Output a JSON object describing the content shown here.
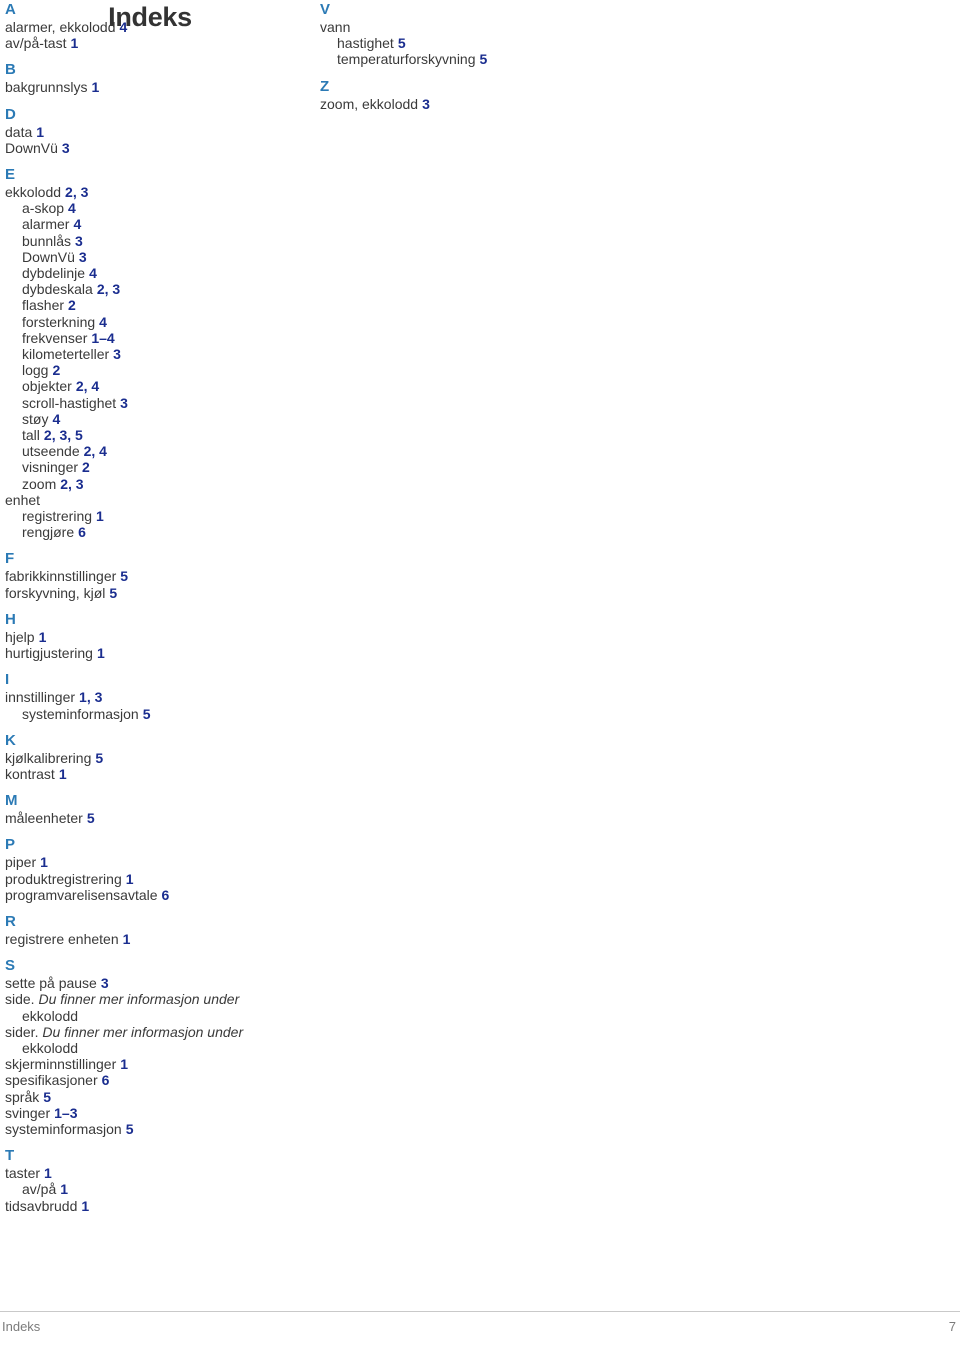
{
  "document": {
    "title": "Indeks"
  },
  "footer": {
    "label": "Indeks",
    "page_number": "7"
  },
  "colors": {
    "section_letter": "#2b7ab5",
    "page_number": "#1a2d8f",
    "body_text": "#3a3a3a",
    "title": "#333333",
    "footer_text": "#7b7b7b",
    "footer_rule": "#c9c9c9"
  },
  "index": {
    "left_column": [
      {
        "letter": "A",
        "entries": [
          {
            "level": 0,
            "term": "alarmer, ekkolodd",
            "pages": "4"
          },
          {
            "level": 0,
            "term": "av/på-tast",
            "pages": "1"
          }
        ]
      },
      {
        "letter": "B",
        "entries": [
          {
            "level": 0,
            "term": "bakgrunnslys",
            "pages": "1"
          }
        ]
      },
      {
        "letter": "D",
        "entries": [
          {
            "level": 0,
            "term": "data",
            "pages": "1"
          },
          {
            "level": 0,
            "term": "DownVü",
            "pages": "3"
          }
        ]
      },
      {
        "letter": "E",
        "entries": [
          {
            "level": 0,
            "term": "ekkolodd",
            "pages": "2, 3"
          },
          {
            "level": 1,
            "term": "a-skop",
            "pages": "4"
          },
          {
            "level": 1,
            "term": "alarmer",
            "pages": "4"
          },
          {
            "level": 1,
            "term": "bunnlås",
            "pages": "3"
          },
          {
            "level": 1,
            "term": "DownVü",
            "pages": "3"
          },
          {
            "level": 1,
            "term": "dybdelinje",
            "pages": "4"
          },
          {
            "level": 1,
            "term": "dybdeskala",
            "pages": "2, 3"
          },
          {
            "level": 1,
            "term": "flasher",
            "pages": "2"
          },
          {
            "level": 1,
            "term": "forsterkning",
            "pages": "4"
          },
          {
            "level": 1,
            "term": "frekvenser",
            "pages": "1–4"
          },
          {
            "level": 1,
            "term": "kilometerteller",
            "pages": "3"
          },
          {
            "level": 1,
            "term": "logg",
            "pages": "2"
          },
          {
            "level": 1,
            "term": "objekter",
            "pages": "2, 4"
          },
          {
            "level": 1,
            "term": "scroll-hastighet",
            "pages": "3"
          },
          {
            "level": 1,
            "term": "støy",
            "pages": "4"
          },
          {
            "level": 1,
            "term": "tall",
            "pages": "2, 3, 5"
          },
          {
            "level": 1,
            "term": "utseende",
            "pages": "2, 4"
          },
          {
            "level": 1,
            "term": "visninger",
            "pages": "2"
          },
          {
            "level": 1,
            "term": "zoom",
            "pages": "2, 3"
          },
          {
            "level": 0,
            "term": "enhet",
            "pages": ""
          },
          {
            "level": 1,
            "term": "registrering",
            "pages": "1"
          },
          {
            "level": 1,
            "term": "rengjøre",
            "pages": "6"
          }
        ]
      },
      {
        "letter": "F",
        "entries": [
          {
            "level": 0,
            "term": "fabrikkinnstillinger",
            "pages": "5"
          },
          {
            "level": 0,
            "term": "forskyvning, kjøl",
            "pages": "5"
          }
        ]
      },
      {
        "letter": "H",
        "entries": [
          {
            "level": 0,
            "term": "hjelp",
            "pages": "1"
          },
          {
            "level": 0,
            "term": "hurtigjustering",
            "pages": "1"
          }
        ]
      },
      {
        "letter": "I",
        "entries": [
          {
            "level": 0,
            "term": "innstillinger",
            "pages": "1, 3"
          },
          {
            "level": 1,
            "term": "systeminformasjon",
            "pages": "5"
          }
        ]
      },
      {
        "letter": "K",
        "entries": [
          {
            "level": 0,
            "term": "kjølkalibrering",
            "pages": "5"
          },
          {
            "level": 0,
            "term": "kontrast",
            "pages": "1"
          }
        ]
      },
      {
        "letter": "M",
        "entries": [
          {
            "level": 0,
            "term": "måleenheter",
            "pages": "5"
          }
        ]
      },
      {
        "letter": "P",
        "entries": [
          {
            "level": 0,
            "term": "piper",
            "pages": "1"
          },
          {
            "level": 0,
            "term": "produktregistrering",
            "pages": "1"
          },
          {
            "level": 0,
            "term": "programvarelisensavtale",
            "pages": "6"
          }
        ]
      },
      {
        "letter": "R",
        "entries": [
          {
            "level": 0,
            "term": "registrere enheten",
            "pages": "1"
          }
        ]
      },
      {
        "letter": "S",
        "entries": [
          {
            "level": 0,
            "term": "sette på pause",
            "pages": "3"
          },
          {
            "level": 0,
            "term": "side.",
            "xref": "Du finner mer informasjon under",
            "pages": ""
          },
          {
            "level": 1,
            "term": "ekkolodd",
            "pages": ""
          },
          {
            "level": 0,
            "term": "sider.",
            "xref": "Du finner mer informasjon under",
            "pages": ""
          },
          {
            "level": 1,
            "term": "ekkolodd",
            "pages": ""
          },
          {
            "level": 0,
            "term": "skjerminnstillinger",
            "pages": "1"
          },
          {
            "level": 0,
            "term": "spesifikasjoner",
            "pages": "6"
          },
          {
            "level": 0,
            "term": "språk",
            "pages": "5"
          },
          {
            "level": 0,
            "term": "svinger",
            "pages": "1–3"
          },
          {
            "level": 0,
            "term": "systeminformasjon",
            "pages": "5"
          }
        ]
      },
      {
        "letter": "T",
        "entries": [
          {
            "level": 0,
            "term": "taster",
            "pages": "1"
          },
          {
            "level": 1,
            "term": "av/på",
            "pages": "1"
          },
          {
            "level": 0,
            "term": "tidsavbrudd",
            "pages": "1"
          }
        ]
      }
    ],
    "right_column": [
      {
        "letter": "V",
        "entries": [
          {
            "level": 0,
            "term": "vann",
            "pages": ""
          },
          {
            "level": 1,
            "term": "hastighet",
            "pages": "5"
          },
          {
            "level": 1,
            "term": "temperaturforskyvning",
            "pages": "5"
          }
        ]
      },
      {
        "letter": "Z",
        "entries": [
          {
            "level": 0,
            "term": "zoom, ekkolodd",
            "pages": "3"
          }
        ]
      }
    ]
  }
}
